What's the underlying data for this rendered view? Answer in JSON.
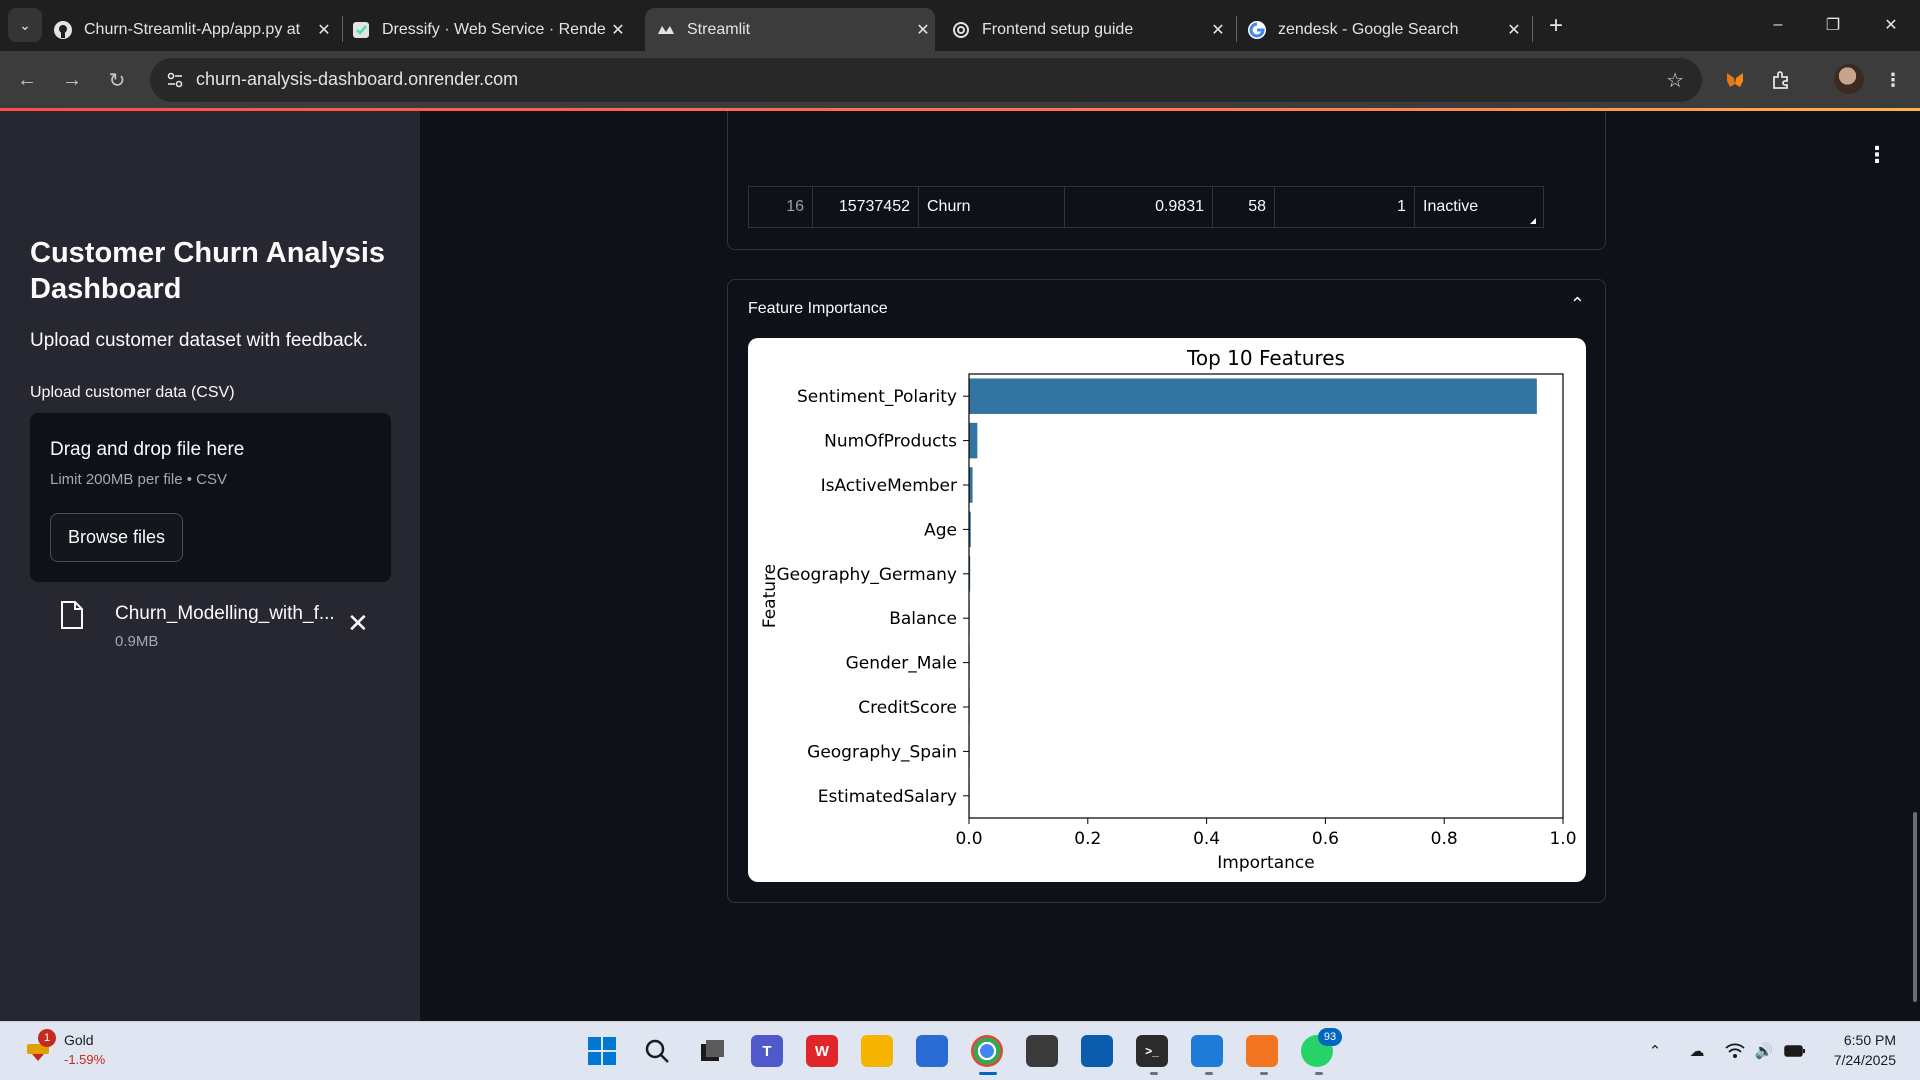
{
  "browser": {
    "tabs": [
      {
        "title": "Churn-Streamlit-App/app.py at",
        "favicon": "github-icon"
      },
      {
        "title": "Dressify · Web Service · Rende",
        "favicon": "render-icon"
      },
      {
        "title": "Streamlit",
        "favicon": "streamlit-icon",
        "active": true
      },
      {
        "title": "Frontend setup guide",
        "favicon": "openai-icon"
      },
      {
        "title": "zendesk - Google Search",
        "favicon": "google-icon"
      }
    ],
    "url": "churn-analysis-dashboard.onrender.com"
  },
  "sidebar": {
    "title": "Customer Churn Analysis Dashboard",
    "subtitle": "Upload customer dataset with feedback.",
    "upload_label": "Upload customer data (CSV)",
    "dropzone_title": "Drag and drop file here",
    "dropzone_limit": "Limit 200MB per file • CSV",
    "browse_label": "Browse files",
    "file_name": "Churn_Modelling_with_f...",
    "file_size": "0.9MB"
  },
  "table": {
    "row": {
      "index": "16",
      "customer_id": "15737452",
      "prediction": "Churn",
      "probability": "0.9831",
      "age": "58",
      "products": "1",
      "status": "Inactive"
    }
  },
  "expander": {
    "title": "Feature Importance"
  },
  "chart_data": {
    "type": "bar",
    "orientation": "horizontal",
    "title": "Top 10 Features",
    "xlabel": "Importance",
    "ylabel": "Feature",
    "categories": [
      "Sentiment_Polarity",
      "NumOfProducts",
      "IsActiveMember",
      "Age",
      "Geography_Germany",
      "Balance",
      "Gender_Male",
      "CreditScore",
      "Geography_Spain",
      "EstimatedSalary"
    ],
    "values": [
      0.956,
      0.014,
      0.006,
      0.003,
      0.002,
      0.001,
      0.001,
      0.0005,
      0.0004,
      0.0003
    ],
    "xlim": [
      0.0,
      1.0
    ],
    "xticks": [
      "0.0",
      "0.2",
      "0.4",
      "0.6",
      "0.8",
      "1.0"
    ],
    "bar_color": "#3274a1",
    "grid": false
  },
  "taskbar": {
    "stock_name": "Gold",
    "stock_change": "-1.59%",
    "stock_badge": "1",
    "whatsapp_badge": "93",
    "time": "6:50 PM",
    "date": "7/24/2025"
  },
  "colors": {
    "sidebar_bg": "#262730",
    "main_bg": "#0e1117",
    "accent": "#ff4b4b"
  }
}
